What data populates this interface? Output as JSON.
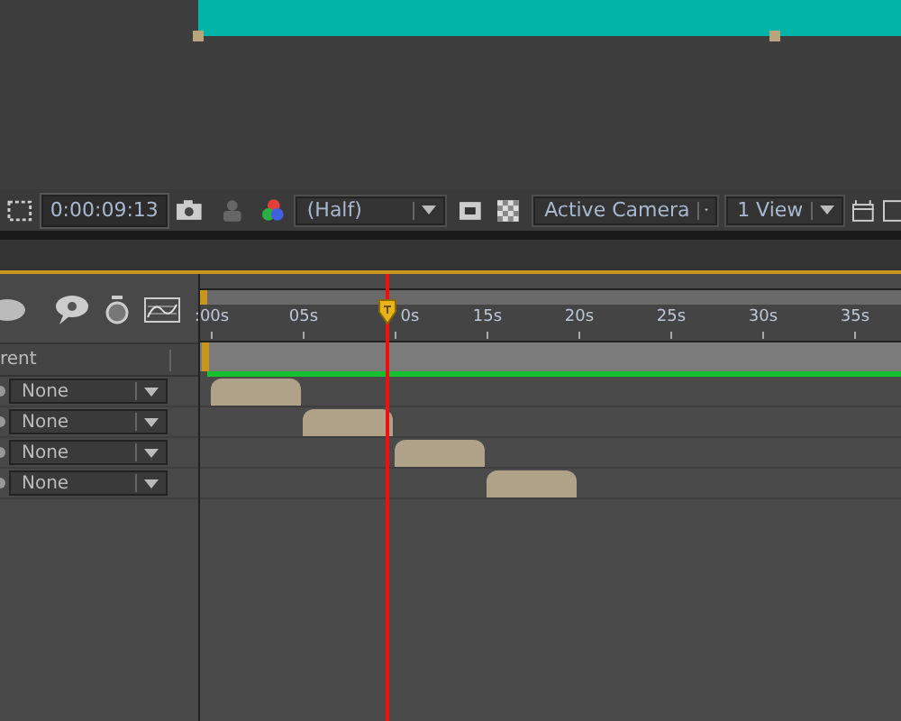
{
  "viewer": {
    "kind": "solid"
  },
  "toolbar": {
    "timecode": "0:00:09:13",
    "resolution": "(Half)",
    "camera": "Active Camera",
    "views": "1 View"
  },
  "timeline": {
    "parent_header": "rent",
    "ruler": [
      ":00s",
      "05s",
      "0s",
      "15s",
      "20s",
      "25s",
      "30s",
      "35s"
    ],
    "layers": [
      {
        "parent": "None"
      },
      {
        "parent": "None"
      },
      {
        "parent": "None"
      },
      {
        "parent": "None"
      }
    ]
  }
}
